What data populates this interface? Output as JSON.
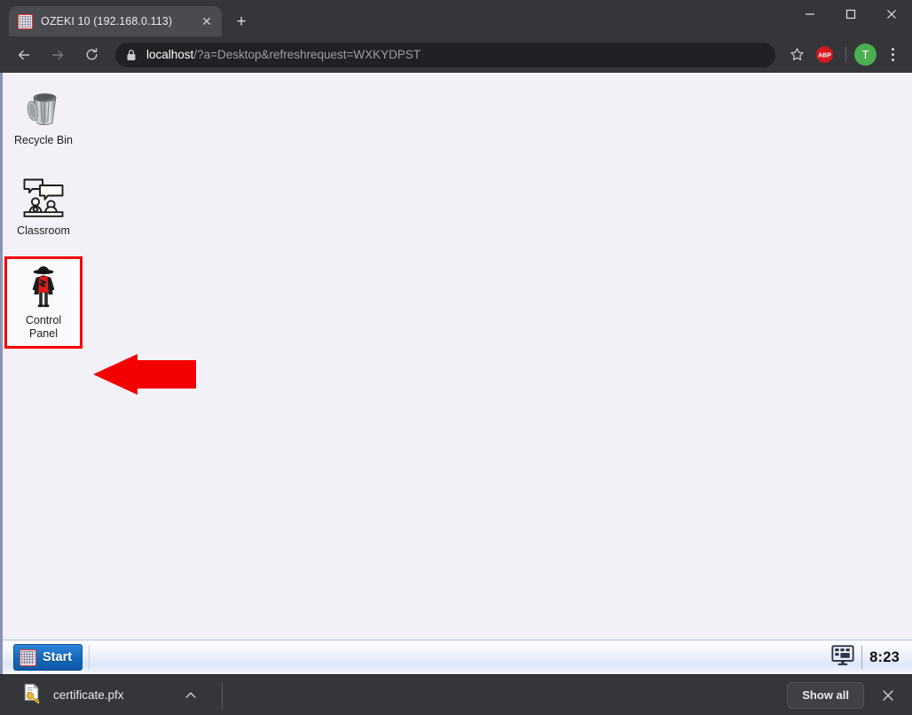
{
  "browser": {
    "tab": {
      "title": "OZEKI 10 (192.168.0.113)",
      "favicon": "ozeki-grid-icon",
      "close_label": "✕"
    },
    "new_tab_label": "+",
    "window_controls": {
      "minimize": "minimize-icon",
      "maximize": "maximize-icon",
      "close": "close-icon"
    },
    "toolbar": {
      "back": "back-arrow-icon",
      "forward": "forward-arrow-icon",
      "reload": "reload-icon",
      "lock": "lock-icon",
      "url_host": "localhost",
      "url_path": "/?a=Desktop&refreshrequest=WXKYDPST",
      "bookmark": "star-icon",
      "extension_abp_label": "ABP",
      "profile_initial": "T",
      "menu": "kebab-menu-icon"
    }
  },
  "desktop": {
    "background_color": "#f1f1f7",
    "icons": [
      {
        "id": "recycle-bin",
        "label": "Recycle Bin",
        "icon": "recycle-bin-icon",
        "selected": false
      },
      {
        "id": "classroom",
        "label": "Classroom",
        "icon": "classroom-icon",
        "selected": false
      },
      {
        "id": "control-panel",
        "label": "Control\nPanel",
        "label_line1": "Control",
        "label_line2": "Panel",
        "icon": "control-panel-icon",
        "selected": true
      }
    ],
    "annotation": {
      "type": "arrow",
      "direction": "left",
      "color": "#f40000",
      "points_to": "control-panel"
    },
    "selection_color": "#f40000"
  },
  "taskbar": {
    "start_label": "Start",
    "start_icon": "ozeki-grid-icon",
    "tray": {
      "show_desktop_icon": "monitor-icon",
      "clock": "8:23"
    }
  },
  "download_shelf": {
    "item": {
      "filename": "certificate.pfx",
      "icon": "certificate-icon",
      "chevron": "chevron-up-icon"
    },
    "show_all_label": "Show all",
    "close_label": "✕"
  }
}
